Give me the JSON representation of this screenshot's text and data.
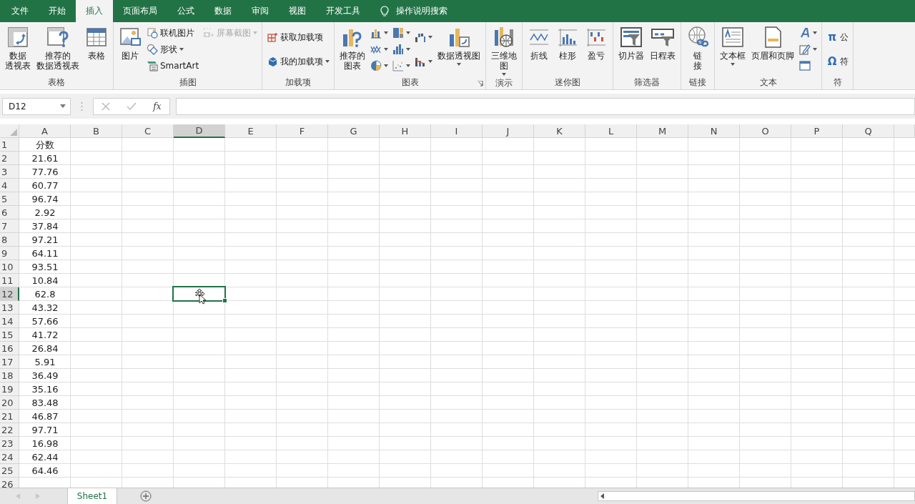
{
  "tabs": [
    {
      "label": "文件",
      "selected": false
    },
    {
      "label": "开始",
      "selected": false
    },
    {
      "label": "插入",
      "selected": true
    },
    {
      "label": "页面布局",
      "selected": false
    },
    {
      "label": "公式",
      "selected": false
    },
    {
      "label": "数据",
      "selected": false
    },
    {
      "label": "审阅",
      "selected": false
    },
    {
      "label": "视图",
      "selected": false
    },
    {
      "label": "开发工具",
      "selected": false
    }
  ],
  "tell_me": "操作说明搜索",
  "ribbon": {
    "groups": [
      {
        "label": "表格",
        "items": [
          {
            "kind": "large",
            "lines": [
              "数据",
              "透视表"
            ],
            "dropdown": false
          },
          {
            "kind": "large",
            "lines": [
              "推荐的",
              "数据透视表"
            ],
            "dropdown": false
          },
          {
            "kind": "large",
            "lines": [
              "表格"
            ],
            "dropdown": false
          }
        ]
      },
      {
        "label": "插图",
        "items": [
          {
            "kind": "large",
            "lines": [
              "图片"
            ],
            "dropdown": false
          },
          {
            "kind": "stack",
            "items": [
              {
                "label": "联机图片",
                "dropdown": false,
                "disabled": false
              },
              {
                "label": "形状",
                "dropdown": true,
                "disabled": false
              },
              {
                "label": "SmartArt",
                "dropdown": false,
                "disabled": false
              }
            ]
          },
          {
            "kind": "stack",
            "items": [
              {
                "label": "屏幕截图",
                "dropdown": true,
                "disabled": true
              }
            ]
          }
        ]
      },
      {
        "label": "加载项",
        "items": [
          {
            "kind": "stack",
            "items": [
              {
                "label": "获取加载项",
                "dropdown": false,
                "disabled": false
              },
              {
                "label": "我的加载项",
                "dropdown": true,
                "disabled": false
              }
            ]
          }
        ]
      },
      {
        "label": "图表",
        "launcher": true,
        "items": [
          {
            "kind": "large",
            "lines": [
              "推荐的",
              "图表"
            ],
            "dropdown": false
          },
          {
            "kind": "stack",
            "items": [
              {
                "dropdown": true,
                "disabled": false
              },
              {
                "dropdown": true,
                "disabled": false
              },
              {
                "dropdown": true,
                "disabled": false
              }
            ]
          },
          {
            "kind": "stack",
            "items": [
              {
                "dropdown": true,
                "disabled": false
              },
              {
                "dropdown": true,
                "disabled": false
              },
              {
                "dropdown": true,
                "disabled": false
              }
            ]
          },
          {
            "kind": "stack",
            "items": [
              {
                "dropdown": true,
                "disabled": false
              },
              {
                "dropdown": true,
                "disabled": false
              }
            ]
          },
          {
            "kind": "large",
            "lines": [
              "数据透视图"
            ],
            "dropdown": true
          }
        ]
      },
      {
        "label": "演示",
        "items": [
          {
            "kind": "large",
            "lines": [
              "三维地",
              "图"
            ],
            "dropdown": true
          }
        ]
      },
      {
        "label": "迷你图",
        "items": [
          {
            "kind": "large",
            "lines": [
              "折线"
            ],
            "dropdown": false
          },
          {
            "kind": "large",
            "lines": [
              "柱形"
            ],
            "dropdown": false
          },
          {
            "kind": "large",
            "lines": [
              "盈亏"
            ],
            "dropdown": false
          }
        ]
      },
      {
        "label": "筛选器",
        "items": [
          {
            "kind": "large",
            "lines": [
              "切片器"
            ],
            "dropdown": false
          },
          {
            "kind": "large",
            "lines": [
              "日程表"
            ],
            "dropdown": false
          }
        ]
      },
      {
        "label": "链接",
        "items": [
          {
            "kind": "large",
            "lines": [
              "链",
              "接"
            ],
            "dropdown": false
          }
        ]
      },
      {
        "label": "文本",
        "items": [
          {
            "kind": "large",
            "lines": [
              "文本框"
            ],
            "dropdown": true
          },
          {
            "kind": "large",
            "lines": [
              "页眉和页脚"
            ],
            "dropdown": false
          },
          {
            "kind": "stack",
            "items": [
              {
                "dropdown": true,
                "disabled": false
              },
              {
                "dropdown": true,
                "disabled": false
              },
              {
                "dropdown": false,
                "disabled": false
              }
            ]
          }
        ]
      },
      {
        "label": "符",
        "items": [
          {
            "kind": "stack",
            "items": [
              {
                "glyph": "π",
                "label": "公",
                "dropdown": false,
                "disabled": false
              },
              {
                "glyph": "Ω",
                "label": "符",
                "dropdown": false,
                "disabled": false
              }
            ]
          }
        ]
      }
    ]
  },
  "formula_bar": {
    "name_box": "D12",
    "fx": "fx"
  },
  "columns": [
    {
      "label": "A",
      "selected": false
    },
    {
      "label": "B",
      "selected": false
    },
    {
      "label": "C",
      "selected": false
    },
    {
      "label": "D",
      "selected": true
    },
    {
      "label": "E",
      "selected": false
    },
    {
      "label": "F",
      "selected": false
    },
    {
      "label": "G",
      "selected": false
    },
    {
      "label": "H",
      "selected": false
    },
    {
      "label": "I",
      "selected": false
    },
    {
      "label": "J",
      "selected": false
    },
    {
      "label": "K",
      "selected": false
    },
    {
      "label": "L",
      "selected": false
    },
    {
      "label": "M",
      "selected": false
    },
    {
      "label": "N",
      "selected": false
    },
    {
      "label": "O",
      "selected": false
    },
    {
      "label": "P",
      "selected": false
    },
    {
      "label": "Q",
      "selected": false
    }
  ],
  "rows": [
    {
      "number": "1",
      "selected": false,
      "cells": [
        "分数"
      ]
    },
    {
      "number": "2",
      "selected": false,
      "cells": [
        "21.61"
      ]
    },
    {
      "number": "3",
      "selected": false,
      "cells": [
        "77.76"
      ]
    },
    {
      "number": "4",
      "selected": false,
      "cells": [
        "60.77"
      ]
    },
    {
      "number": "5",
      "selected": false,
      "cells": [
        "96.74"
      ]
    },
    {
      "number": "6",
      "selected": false,
      "cells": [
        "2.92"
      ]
    },
    {
      "number": "7",
      "selected": false,
      "cells": [
        "37.84"
      ]
    },
    {
      "number": "8",
      "selected": false,
      "cells": [
        "97.21"
      ]
    },
    {
      "number": "9",
      "selected": false,
      "cells": [
        "64.11"
      ]
    },
    {
      "number": "10",
      "selected": false,
      "cells": [
        "93.51"
      ]
    },
    {
      "number": "11",
      "selected": false,
      "cells": [
        "10.84"
      ]
    },
    {
      "number": "12",
      "selected": true,
      "cells": [
        "62.8"
      ]
    },
    {
      "number": "13",
      "selected": false,
      "cells": [
        "43.32"
      ]
    },
    {
      "number": "14",
      "selected": false,
      "cells": [
        "57.66"
      ]
    },
    {
      "number": "15",
      "selected": false,
      "cells": [
        "41.72"
      ]
    },
    {
      "number": "16",
      "selected": false,
      "cells": [
        "26.84"
      ]
    },
    {
      "number": "17",
      "selected": false,
      "cells": [
        "5.91"
      ]
    },
    {
      "number": "18",
      "selected": false,
      "cells": [
        "36.49"
      ]
    },
    {
      "number": "19",
      "selected": false,
      "cells": [
        "35.16"
      ]
    },
    {
      "number": "20",
      "selected": false,
      "cells": [
        "83.48"
      ]
    },
    {
      "number": "21",
      "selected": false,
      "cells": [
        "46.87"
      ]
    },
    {
      "number": "22",
      "selected": false,
      "cells": [
        "97.71"
      ]
    },
    {
      "number": "23",
      "selected": false,
      "cells": [
        "16.98"
      ]
    },
    {
      "number": "24",
      "selected": false,
      "cells": [
        "62.44"
      ]
    },
    {
      "number": "25",
      "selected": false,
      "cells": [
        "64.46"
      ]
    },
    {
      "number": "26",
      "selected": false,
      "cells": []
    }
  ],
  "sheets": [
    {
      "label": "Sheet1",
      "selected": true
    }
  ]
}
